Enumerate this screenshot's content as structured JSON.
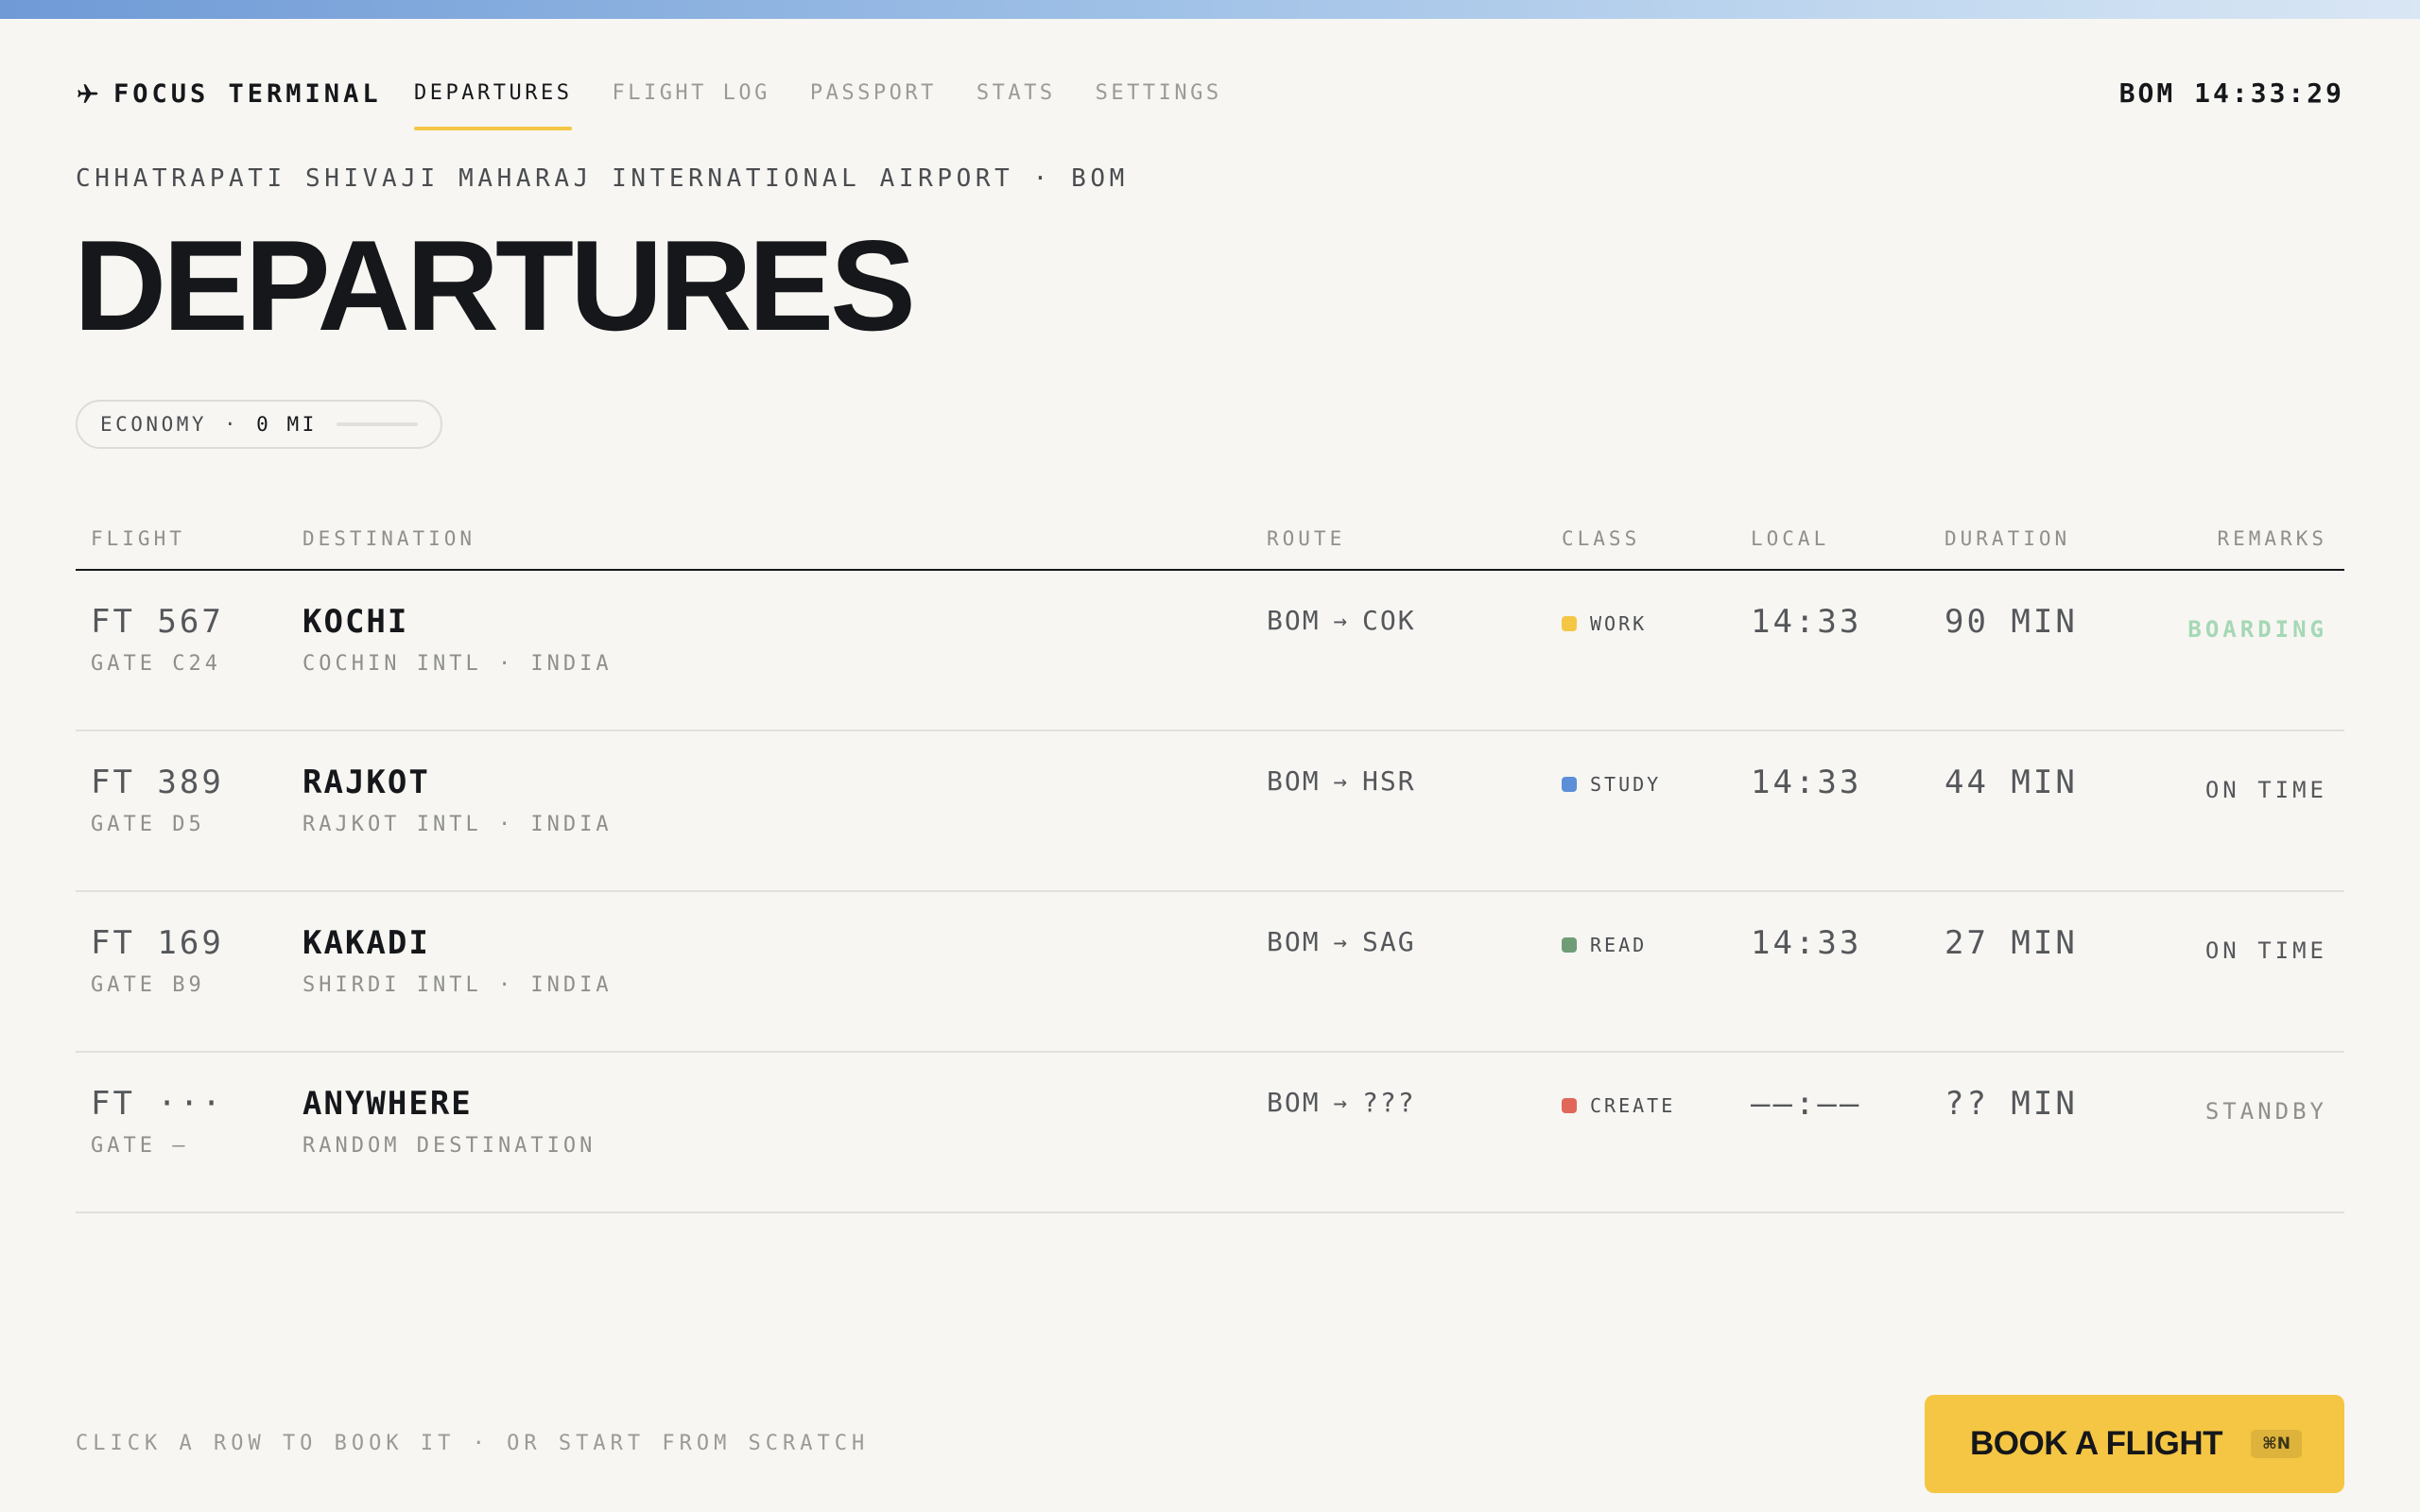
{
  "brand": {
    "name": "FOCUS TERMINAL",
    "icon": "plane-icon"
  },
  "nav": {
    "items": [
      {
        "label": "DEPARTURES",
        "active": true
      },
      {
        "label": "FLIGHT LOG",
        "active": false
      },
      {
        "label": "PASSPORT",
        "active": false
      },
      {
        "label": "STATS",
        "active": false
      },
      {
        "label": "SETTINGS",
        "active": false
      }
    ]
  },
  "clock": "BOM 14:33:29",
  "airport": "CHHATRAPATI SHIVAJI MAHARAJ INTERNATIONAL AIRPORT · BOM",
  "title": "DEPARTURES",
  "tier": {
    "label": "ECONOMY",
    "separator": "·",
    "miles": "0 MI",
    "progress": 0
  },
  "table": {
    "headers": {
      "flight": "FLIGHT",
      "destination": "DESTINATION",
      "route": "ROUTE",
      "class": "CLASS",
      "local": "LOCAL",
      "duration": "DURATION",
      "remarks": "REMARKS"
    },
    "rows": [
      {
        "flight": "FT 567",
        "gate": "GATE C24",
        "destination": "KOCHI",
        "dest_sub": "COCHIN INTL · INDIA",
        "from": "BOM",
        "to": "COK",
        "class": "WORK",
        "class_color": "#f4c644",
        "local": "14:33",
        "duration": "90 MIN",
        "remark": "BOARDING"
      },
      {
        "flight": "FT 389",
        "gate": "GATE D5",
        "destination": "RAJKOT",
        "dest_sub": "RAJKOT INTL · INDIA",
        "from": "BOM",
        "to": "HSR",
        "class": "STUDY",
        "class_color": "#5b8fd8",
        "local": "14:33",
        "duration": "44 MIN",
        "remark": "ON TIME"
      },
      {
        "flight": "FT 169",
        "gate": "GATE B9",
        "destination": "KAKADI",
        "dest_sub": "SHIRDI INTL · INDIA",
        "from": "BOM",
        "to": "SAG",
        "class": "READ",
        "class_color": "#6f9e76",
        "local": "14:33",
        "duration": "27 MIN",
        "remark": "ON TIME"
      },
      {
        "flight": "FT ···",
        "gate": "GATE —",
        "destination": "ANYWHERE",
        "dest_sub": "RANDOM DESTINATION",
        "from": "BOM",
        "to": "???",
        "class": "CREATE",
        "class_color": "#e0675a",
        "local": "——:——",
        "duration": "?? MIN",
        "remark": "STANDBY"
      }
    ]
  },
  "footer": {
    "hint": "CLICK A ROW TO BOOK IT · OR START FROM SCRATCH",
    "book_label": "BOOK A FLIGHT",
    "shortcut": "⌘N"
  },
  "colors": {
    "accent": "#f4c644",
    "background": "#f7f6f2",
    "ink": "#15171a",
    "boarding": "#a5d8b6"
  }
}
